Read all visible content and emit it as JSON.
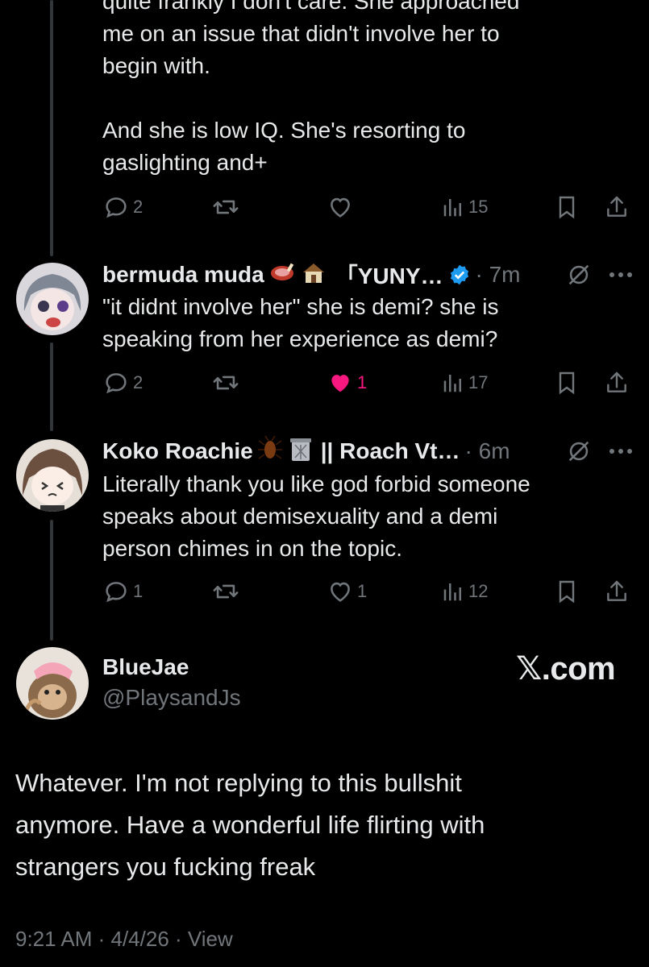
{
  "top_post": {
    "text": "quite frankly I don't care. She approached\nme on an issue that didn't involve her to\nbegin with.\n\nAnd she is low IQ. She's resorting to\ngaslighting and+",
    "replies": "2",
    "views": "15"
  },
  "reply1": {
    "name": "bermuda muda",
    "name_suffix": "「YUNY…",
    "emoji": [
      "meat-emoji",
      "house-emoji"
    ],
    "time": "· 7m",
    "text": "\"it didnt involve her\" she is demi? she is\nspeaking from her experience as demi?",
    "replies": "2",
    "likes": "1",
    "views": "17",
    "verified_color": "#1d9bf0",
    "like_color": "#f91880"
  },
  "reply2": {
    "name": "Koko Roachie",
    "name_suffix": "|| Roach Vt…",
    "emoji": [
      "cockroach-emoji",
      "trash-can-emoji"
    ],
    "time": "· 6m",
    "text": "Literally thank you like god forbid someone\nspeaks about demisexuality and a demi\nperson chimes in on the topic.",
    "replies": "1",
    "likes": "1",
    "views": "12"
  },
  "main_post": {
    "name": "BlueJae",
    "handle": "@PlaysandJs",
    "watermark": "𝕏.com",
    "text": "Whatever. I'm not replying to this bullshit\nanymore. Have a wonderful life flirting with\nstrangers you fucking freak",
    "meta": "9:21 AM · 4/4/26 · View"
  }
}
